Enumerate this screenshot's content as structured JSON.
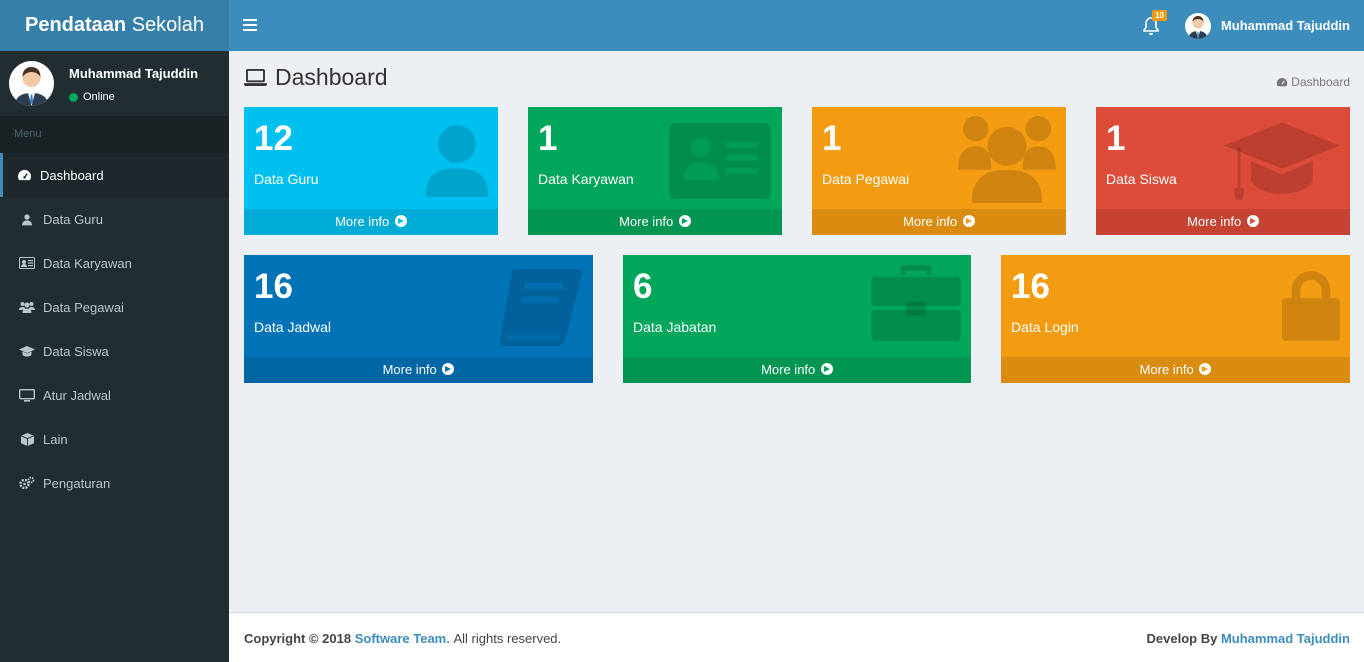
{
  "brand": {
    "bold": "Pendataan",
    "rest": " Sekolah"
  },
  "navbar": {
    "notification_count": "10",
    "user_name": "Muhammad Tajuddin"
  },
  "sidebar": {
    "user_name": "Muhammad Tajuddin",
    "status": "Online",
    "menu_header": "Menu",
    "items": [
      {
        "label": "Dashboard",
        "icon": "dashboard-icon"
      },
      {
        "label": "Data Guru",
        "icon": "user-icon"
      },
      {
        "label": "Data Karyawan",
        "icon": "id-card-icon"
      },
      {
        "label": "Data Pegawai",
        "icon": "users-icon"
      },
      {
        "label": "Data Siswa",
        "icon": "graduation-cap-icon"
      },
      {
        "label": "Atur Jadwal",
        "icon": "desktop-icon"
      },
      {
        "label": "Lain",
        "icon": "cube-icon"
      },
      {
        "label": "Pengaturan",
        "icon": "cogs-icon"
      }
    ]
  },
  "page": {
    "title": "Dashboard",
    "breadcrumb": "Dashboard"
  },
  "boxes": [
    {
      "count": "12",
      "label": "Data Guru",
      "more": "More info",
      "color": "#00c0ef",
      "icon": "user-icon"
    },
    {
      "count": "1",
      "label": "Data Karyawan",
      "more": "More info",
      "color": "#00a65a",
      "icon": "id-card-icon"
    },
    {
      "count": "1",
      "label": "Data Pegawai",
      "more": "More info",
      "color": "#f39c12",
      "icon": "users-icon"
    },
    {
      "count": "1",
      "label": "Data Siswa",
      "more": "More info",
      "color": "#dd4b39",
      "icon": "graduation-cap-icon"
    },
    {
      "count": "16",
      "label": "Data Jadwal",
      "more": "More info",
      "color": "#0073b7",
      "icon": "book-icon"
    },
    {
      "count": "6",
      "label": "Data Jabatan",
      "more": "More info",
      "color": "#00a65a",
      "icon": "briefcase-icon"
    },
    {
      "count": "16",
      "label": "Data Login",
      "more": "More info",
      "color": "#f39c12",
      "icon": "lock-icon"
    }
  ],
  "footer": {
    "copyright": "Copyright © 2018",
    "team": "Software Team.",
    "rights": "All rights reserved.",
    "develop_by": "Develop By",
    "developer": "Muhammad Tajuddin"
  }
}
